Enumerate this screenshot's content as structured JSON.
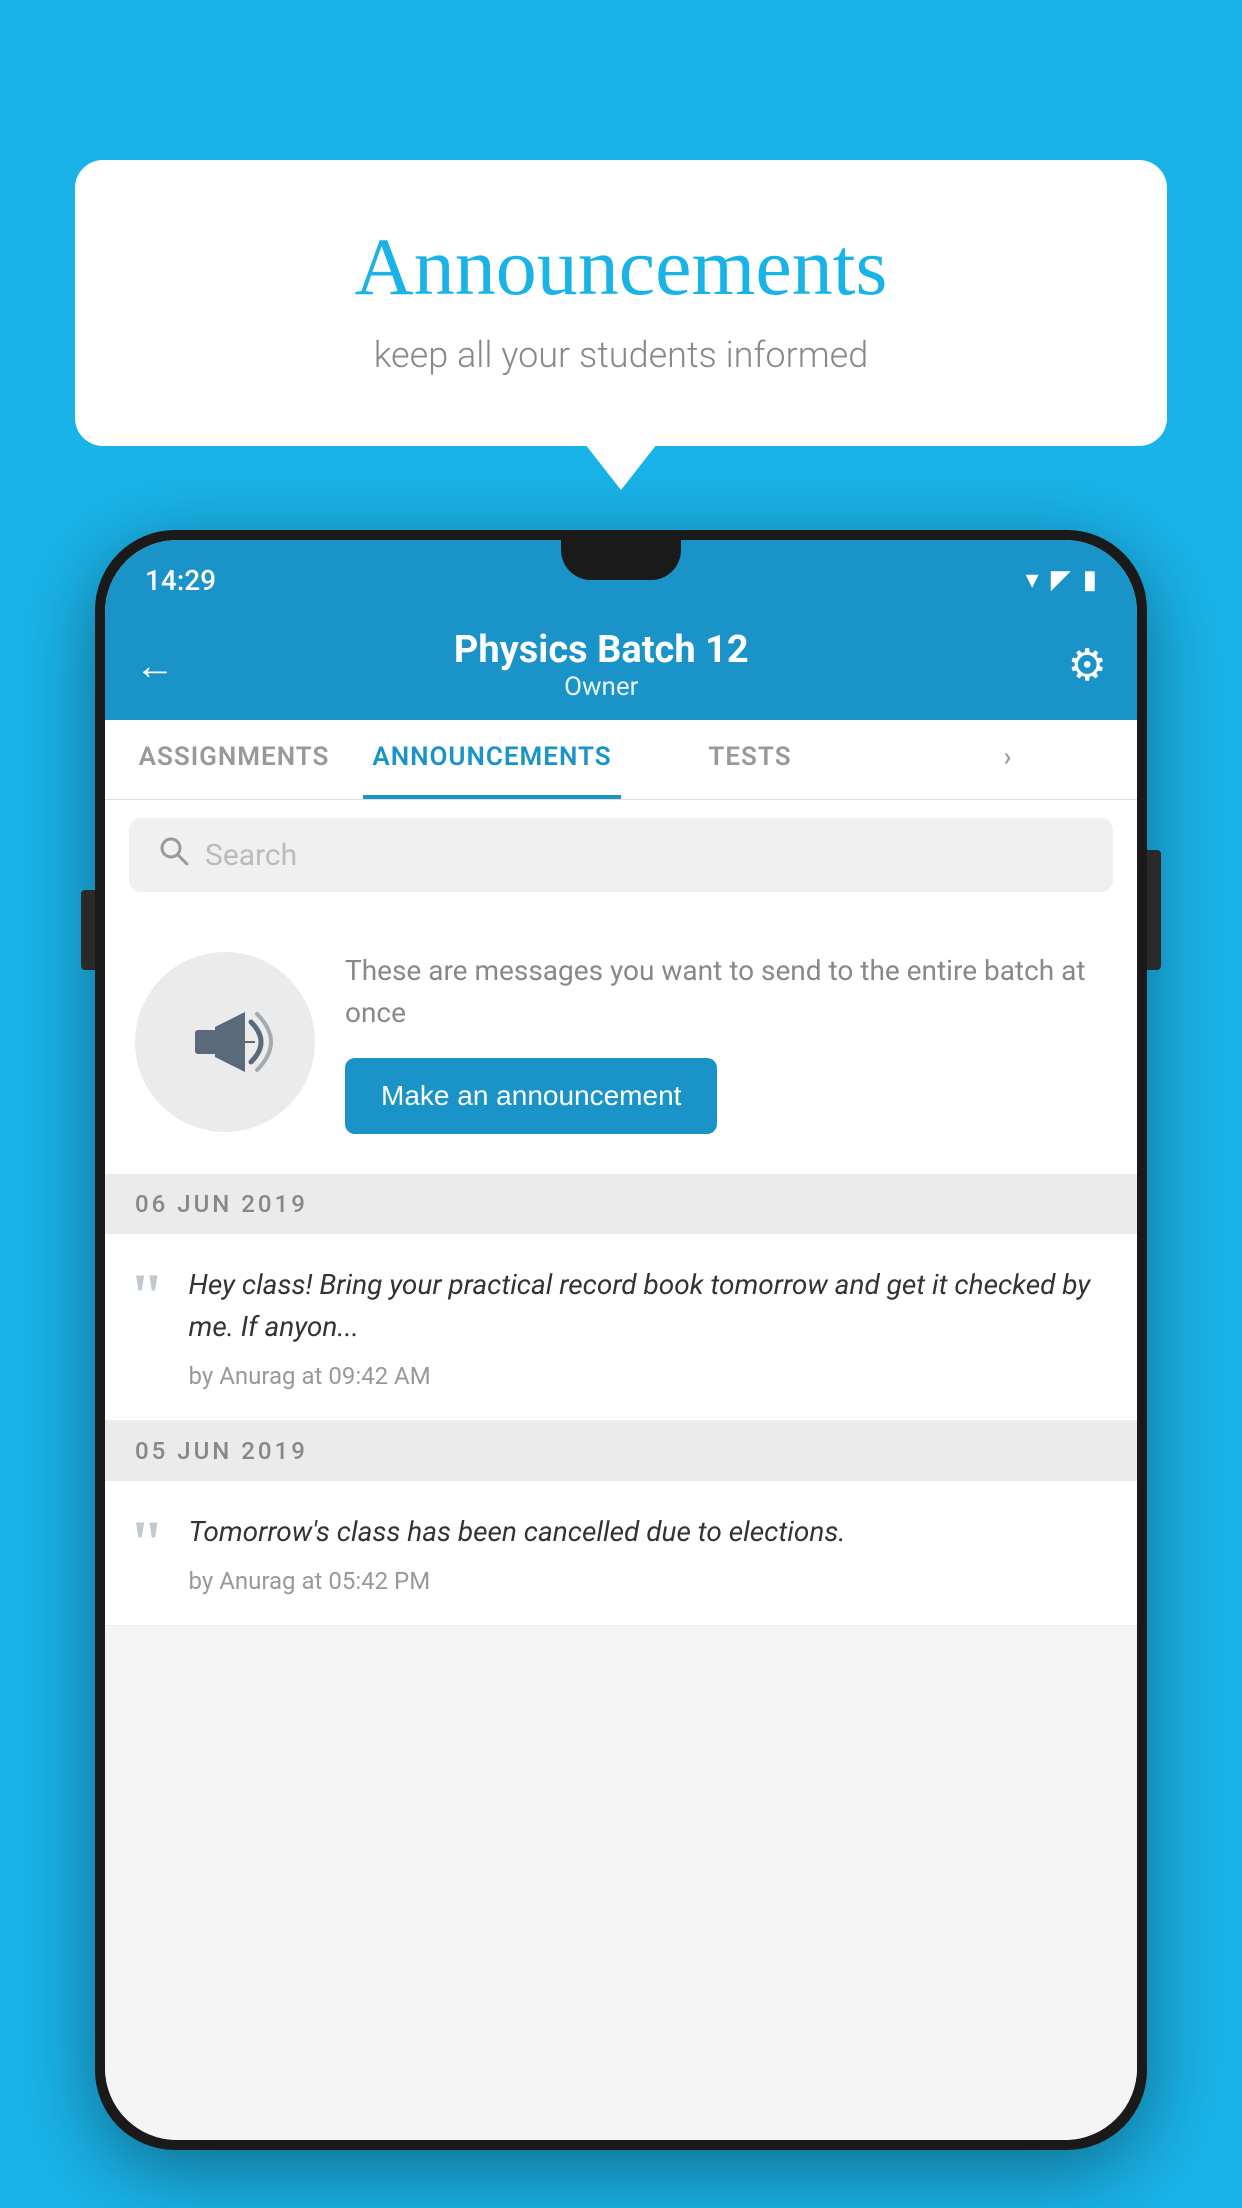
{
  "page": {
    "background_color": "#1ab3e8"
  },
  "speech_bubble": {
    "title": "Announcements",
    "subtitle": "keep all your students informed"
  },
  "status_bar": {
    "time": "14:29",
    "wifi_icon": "▾",
    "signal_icon": "▲",
    "battery_icon": "▮"
  },
  "app_bar": {
    "back_label": "←",
    "title": "Physics Batch 12",
    "subtitle": "Owner",
    "settings_icon": "⚙"
  },
  "tabs": [
    {
      "label": "ASSIGNMENTS",
      "active": false
    },
    {
      "label": "ANNOUNCEMENTS",
      "active": true
    },
    {
      "label": "TESTS",
      "active": false
    },
    {
      "label": "",
      "active": false
    }
  ],
  "search": {
    "placeholder": "Search",
    "icon": "🔍"
  },
  "announcement_prompt": {
    "icon": "📣",
    "description": "These are messages you want to send to the entire batch at once",
    "button_label": "Make an announcement"
  },
  "announcement_items": [
    {
      "date": "06  JUN  2019",
      "message": "Hey class! Bring your practical record book tomorrow and get it checked by me. If anyon...",
      "meta": "by Anurag at 09:42 AM"
    },
    {
      "date": "05  JUN  2019",
      "message": "Tomorrow's class has been cancelled due to elections.",
      "meta": "by Anurag at 05:42 PM"
    }
  ]
}
